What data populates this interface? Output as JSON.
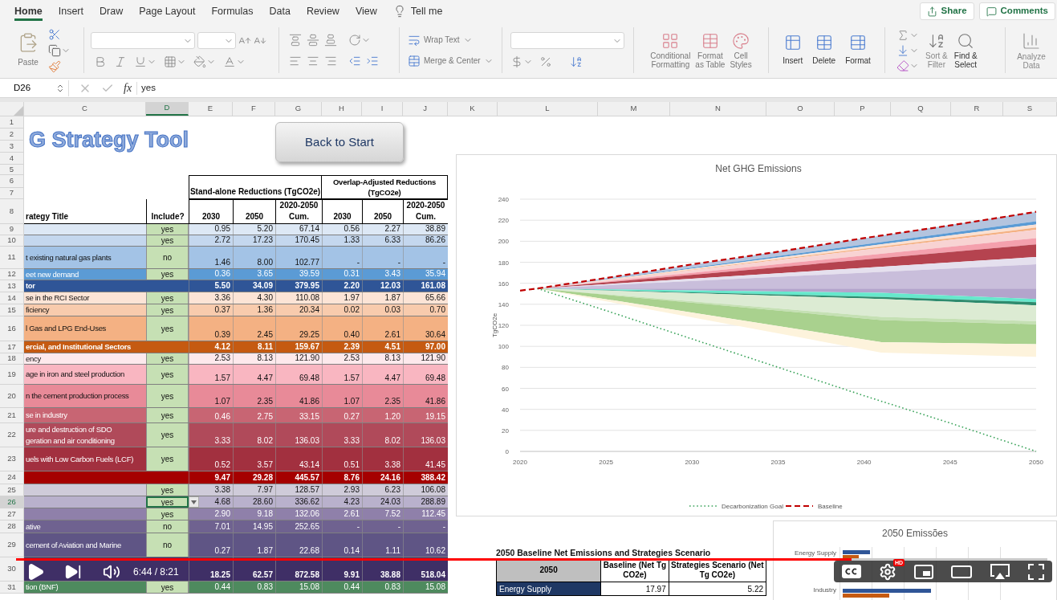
{
  "ribbon": {
    "tabs": [
      {
        "label": "Home",
        "kind": "tab",
        "selected": true
      },
      {
        "label": "Insert",
        "kind": "tab",
        "selected": false
      },
      {
        "label": "Draw",
        "kind": "tab",
        "selected": false
      },
      {
        "label": "Page Layout",
        "kind": "tab",
        "selected": false
      },
      {
        "label": "Formulas",
        "kind": "tab",
        "selected": false
      },
      {
        "label": "Data",
        "kind": "tab",
        "selected": false
      },
      {
        "label": "Review",
        "kind": "tab",
        "selected": false
      },
      {
        "label": "View",
        "kind": "tab",
        "selected": false
      },
      {
        "label": "Tell me",
        "kind": "search",
        "selected": false
      }
    ],
    "share": "Share",
    "comments": "Comments",
    "paste": "Paste",
    "wrap_text": "Wrap Text",
    "merge": "Merge & Center",
    "styles": [
      "Conditional\nFormatting",
      "Format\nas Table",
      "Cell\nStyles"
    ],
    "cells": [
      "Insert",
      "Delete",
      "Format"
    ],
    "editing": [
      "Sort &\nFilter",
      "Find &\nSelect"
    ],
    "analyze": "Analyze\nData"
  },
  "formula_bar": {
    "name_box": "D26",
    "fx": "fx",
    "value": "yes"
  },
  "sheet": {
    "columns": [
      {
        "label": "C",
        "selected": false
      },
      {
        "label": "D",
        "selected": true
      },
      {
        "label": "E",
        "selected": false
      },
      {
        "label": "F",
        "selected": false
      },
      {
        "label": "G",
        "selected": false
      },
      {
        "label": "H",
        "selected": false
      },
      {
        "label": "I",
        "selected": false
      },
      {
        "label": "J",
        "selected": false
      },
      {
        "label": "K",
        "selected": false
      },
      {
        "label": "L",
        "selected": false
      },
      {
        "label": "M",
        "selected": false
      },
      {
        "label": "N",
        "selected": false
      },
      {
        "label": "O",
        "selected": false
      },
      {
        "label": "P",
        "selected": false
      },
      {
        "label": "Q",
        "selected": false
      },
      {
        "label": "R",
        "selected": false
      },
      {
        "label": "S",
        "selected": false
      }
    ],
    "title_rows": [
      "1",
      "2",
      "3",
      "4",
      "5"
    ],
    "title": "G Strategy Tool",
    "back_button": "Back to Start",
    "group_rows": [
      "6",
      "7"
    ],
    "groups": [
      "Stand-alone Reductions (TgCO2e)",
      "Overlap-Adjusted Reductions (TgCO2e)"
    ],
    "header_row": {
      "number": "8",
      "cells": [
        "rategy Title",
        "Include?",
        "2030",
        "2050",
        "2020-2050 Cum.",
        "2030",
        "2050",
        "2020-2050 Cum."
      ]
    },
    "rows": [
      {
        "number": "9",
        "kind": "strategy",
        "color": "#dde8f5",
        "title": "",
        "include": "yes",
        "selected": false,
        "values": [
          "0.95",
          "5.20",
          "67.14",
          "0.56",
          "2.27",
          "38.89"
        ]
      },
      {
        "number": "10",
        "kind": "strategy",
        "color": "#c4d7ee",
        "title": "",
        "include": "yes",
        "selected": false,
        "values": [
          "2.72",
          "17.23",
          "170.45",
          "1.33",
          "6.33",
          "86.26"
        ]
      },
      {
        "number": "11",
        "kind": "strategy",
        "color": "#a3c3e6",
        "title": "t existing natural gas plants",
        "include": "no",
        "selected": false,
        "values": [
          "1.46",
          "8.00",
          "102.77",
          "-",
          "-",
          "-"
        ]
      },
      {
        "number": "12",
        "kind": "strategy",
        "color": "#5b9bd5",
        "title": "eet new demand",
        "include": "yes",
        "selected": false,
        "values": [
          "0.36",
          "3.65",
          "39.59",
          "0.31",
          "3.43",
          "35.94"
        ]
      },
      {
        "number": "13",
        "kind": "subtotal",
        "color": "#2f5597",
        "title": "tor",
        "include": "",
        "selected": false,
        "values": [
          "5.50",
          "34.09",
          "379.95",
          "2.20",
          "12.03",
          "161.08"
        ]
      },
      {
        "number": "14",
        "kind": "strategy",
        "color": "#fce4d6",
        "title": "se in the RCI Sector",
        "include": "yes",
        "selected": false,
        "values": [
          "3.36",
          "4.30",
          "110.08",
          "1.97",
          "1.87",
          "65.66"
        ]
      },
      {
        "number": "15",
        "kind": "strategy",
        "color": "#f8cbad",
        "title": "ficiency",
        "include": "yes",
        "selected": false,
        "values": [
          "0.37",
          "1.36",
          "20.34",
          "0.02",
          "0.03",
          "0.70"
        ]
      },
      {
        "number": "16",
        "kind": "strategy",
        "color": "#f4b183",
        "title": "l Gas and LPG End-Uses",
        "include": "yes",
        "selected": false,
        "values": [
          "0.39",
          "2.45",
          "29.25",
          "0.40",
          "2.61",
          "30.64"
        ]
      },
      {
        "number": "17",
        "kind": "subtotal",
        "color": "#c55a11",
        "title": "ercial, and Institutional Sectors",
        "include": "",
        "selected": false,
        "values": [
          "4.12",
          "8.11",
          "159.67",
          "2.39",
          "4.51",
          "97.00"
        ]
      },
      {
        "number": "18",
        "kind": "strategy",
        "color": "#fde9ec",
        "title": "ency",
        "include": "yes",
        "selected": false,
        "values": [
          "2.53",
          "8.13",
          "121.90",
          "2.53",
          "8.13",
          "121.90"
        ]
      },
      {
        "number": "19",
        "kind": "strategy",
        "color": "#f9b6c1",
        "title": "age in iron and steel production",
        "include": "yes",
        "selected": false,
        "values": [
          "1.57",
          "4.47",
          "69.48",
          "1.57",
          "4.47",
          "69.48"
        ]
      },
      {
        "number": "20",
        "kind": "strategy",
        "color": "#e88a98",
        "title": "n the cement production process",
        "include": "yes",
        "selected": false,
        "values": [
          "1.07",
          "2.35",
          "41.86",
          "1.07",
          "2.35",
          "41.86"
        ]
      },
      {
        "number": "21",
        "kind": "strategy",
        "color": "#c86573",
        "title": "se in industry",
        "include": "yes",
        "selected": false,
        "values": [
          "0.46",
          "2.75",
          "33.15",
          "0.27",
          "1.20",
          "19.15"
        ]
      },
      {
        "number": "22",
        "kind": "strategy",
        "color": "#b04a5a",
        "title": "ure and destruction of SDO\ngeration and air conditioning",
        "include": "yes",
        "selected": false,
        "values": [
          "3.33",
          "8.02",
          "136.03",
          "3.33",
          "8.02",
          "136.03"
        ]
      },
      {
        "number": "23",
        "kind": "strategy",
        "color": "#a2303f",
        "title": "uels with Low Carbon Fuels (LCF)",
        "include": "yes",
        "selected": false,
        "values": [
          "0.52",
          "3.57",
          "43.14",
          "0.51",
          "3.38",
          "41.45"
        ]
      },
      {
        "number": "24",
        "kind": "subtotal",
        "color": "#a50000",
        "title": "",
        "include": "",
        "selected": false,
        "values": [
          "9.47",
          "29.28",
          "445.57",
          "8.76",
          "24.16",
          "388.42"
        ]
      },
      {
        "number": "25",
        "kind": "strategy",
        "color": "#cfcbd9",
        "title": "",
        "include": "yes",
        "selected": false,
        "values": [
          "3.38",
          "7.97",
          "128.57",
          "2.93",
          "6.23",
          "106.08"
        ]
      },
      {
        "number": "26",
        "kind": "strategy",
        "color": "#b9b1cc",
        "title": "",
        "include": "yes",
        "selected": true,
        "values": [
          "4.68",
          "28.60",
          "336.62",
          "4.23",
          "24.03",
          "288.89"
        ]
      },
      {
        "number": "27",
        "kind": "strategy",
        "color": "#8f80aa",
        "title": "",
        "include": "yes",
        "selected": false,
        "values": [
          "2.90",
          "9.18",
          "132.06",
          "2.61",
          "7.52",
          "112.45"
        ]
      },
      {
        "number": "28",
        "kind": "strategy",
        "color": "#6f6290",
        "title": "ative",
        "include": "no",
        "selected": false,
        "values": [
          "7.01",
          "14.95",
          "252.65",
          "-",
          "-",
          "-"
        ]
      },
      {
        "number": "29",
        "kind": "strategy",
        "color": "#5f5585",
        "title": "cement of Aviation and Marine",
        "include": "no",
        "selected": false,
        "values": [
          "0.27",
          "1.87",
          "22.68",
          "0.14",
          "1.11",
          "10.62"
        ]
      },
      {
        "number": "30",
        "kind": "subtotal",
        "color": "#3f2f66",
        "title": "",
        "include": "",
        "selected": false,
        "values": [
          "18.25",
          "62.57",
          "872.58",
          "9.91",
          "38.88",
          "518.04"
        ]
      },
      {
        "number": "31",
        "kind": "strategy",
        "color": "#4e8a5e",
        "title": "tion (BNF)",
        "include": "yes",
        "selected": false,
        "values": [
          "0.44",
          "0.83",
          "15.08",
          "0.44",
          "0.83",
          "15.08"
        ]
      }
    ]
  },
  "emissions_chart": {
    "chart_data": {
      "type": "line",
      "title": "Net GHG Emissions",
      "ylabel": "TgCO2e",
      "x": [
        2020,
        2021,
        2025,
        2030,
        2035,
        2040,
        2045,
        2050
      ],
      "series": [
        {
          "name": "Decarbonization Goal",
          "color": "#3aa35a",
          "line_style": "dotted",
          "values": [
            null,
            155,
            134,
            107,
            80,
            53,
            27,
            0
          ]
        },
        {
          "name": "Baseline",
          "color": "#c00000",
          "line_style": "dashed",
          "values": [
            153,
            155,
            165,
            178,
            190,
            203,
            215,
            228
          ]
        }
      ],
      "grid": true,
      "legend": "bottom",
      "xlim": [
        2020,
        2050
      ],
      "ylim": [
        0,
        240
      ],
      "xticks": [
        2020,
        2025,
        2030,
        2035,
        2040,
        2045,
        2050
      ],
      "yticks": [
        0,
        20,
        40,
        60,
        80,
        100,
        120,
        140,
        160,
        180,
        200,
        220,
        240
      ]
    }
  },
  "summary_table": {
    "title": "2050 Baseline Net Emissions and Strategies Scenario",
    "columns": [
      "2050",
      "Baseline (Net Tg CO2e)",
      "Strategies Scenario (Net Tg CO2e)"
    ],
    "rows": [
      {
        "cells": [
          "Energy Supply",
          "17.97",
          "5.22"
        ]
      }
    ]
  },
  "emissions_2050_chart": {
    "title": "2050 Emissões",
    "category_labels": [
      "Energy Supply",
      "Industry"
    ]
  },
  "player": {
    "progress": {
      "level": 0.81
    },
    "time": "6:44 / 8:21",
    "hd_badge": "HD"
  }
}
